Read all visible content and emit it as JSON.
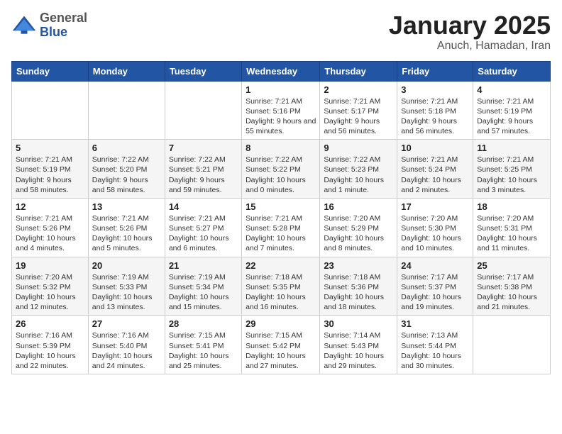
{
  "header": {
    "logo_general": "General",
    "logo_blue": "Blue",
    "month_title": "January 2025",
    "location": "Anuch, Hamadan, Iran"
  },
  "weekdays": [
    "Sunday",
    "Monday",
    "Tuesday",
    "Wednesday",
    "Thursday",
    "Friday",
    "Saturday"
  ],
  "weeks": [
    [
      {
        "day": "",
        "content": ""
      },
      {
        "day": "",
        "content": ""
      },
      {
        "day": "",
        "content": ""
      },
      {
        "day": "1",
        "content": "Sunrise: 7:21 AM\nSunset: 5:16 PM\nDaylight: 9 hours\nand 55 minutes."
      },
      {
        "day": "2",
        "content": "Sunrise: 7:21 AM\nSunset: 5:17 PM\nDaylight: 9 hours\nand 56 minutes."
      },
      {
        "day": "3",
        "content": "Sunrise: 7:21 AM\nSunset: 5:18 PM\nDaylight: 9 hours\nand 56 minutes."
      },
      {
        "day": "4",
        "content": "Sunrise: 7:21 AM\nSunset: 5:19 PM\nDaylight: 9 hours\nand 57 minutes."
      }
    ],
    [
      {
        "day": "5",
        "content": "Sunrise: 7:21 AM\nSunset: 5:19 PM\nDaylight: 9 hours\nand 58 minutes."
      },
      {
        "day": "6",
        "content": "Sunrise: 7:22 AM\nSunset: 5:20 PM\nDaylight: 9 hours\nand 58 minutes."
      },
      {
        "day": "7",
        "content": "Sunrise: 7:22 AM\nSunset: 5:21 PM\nDaylight: 9 hours\nand 59 minutes."
      },
      {
        "day": "8",
        "content": "Sunrise: 7:22 AM\nSunset: 5:22 PM\nDaylight: 10 hours\nand 0 minutes."
      },
      {
        "day": "9",
        "content": "Sunrise: 7:22 AM\nSunset: 5:23 PM\nDaylight: 10 hours\nand 1 minute."
      },
      {
        "day": "10",
        "content": "Sunrise: 7:21 AM\nSunset: 5:24 PM\nDaylight: 10 hours\nand 2 minutes."
      },
      {
        "day": "11",
        "content": "Sunrise: 7:21 AM\nSunset: 5:25 PM\nDaylight: 10 hours\nand 3 minutes."
      }
    ],
    [
      {
        "day": "12",
        "content": "Sunrise: 7:21 AM\nSunset: 5:26 PM\nDaylight: 10 hours\nand 4 minutes."
      },
      {
        "day": "13",
        "content": "Sunrise: 7:21 AM\nSunset: 5:26 PM\nDaylight: 10 hours\nand 5 minutes."
      },
      {
        "day": "14",
        "content": "Sunrise: 7:21 AM\nSunset: 5:27 PM\nDaylight: 10 hours\nand 6 minutes."
      },
      {
        "day": "15",
        "content": "Sunrise: 7:21 AM\nSunset: 5:28 PM\nDaylight: 10 hours\nand 7 minutes."
      },
      {
        "day": "16",
        "content": "Sunrise: 7:20 AM\nSunset: 5:29 PM\nDaylight: 10 hours\nand 8 minutes."
      },
      {
        "day": "17",
        "content": "Sunrise: 7:20 AM\nSunset: 5:30 PM\nDaylight: 10 hours\nand 10 minutes."
      },
      {
        "day": "18",
        "content": "Sunrise: 7:20 AM\nSunset: 5:31 PM\nDaylight: 10 hours\nand 11 minutes."
      }
    ],
    [
      {
        "day": "19",
        "content": "Sunrise: 7:20 AM\nSunset: 5:32 PM\nDaylight: 10 hours\nand 12 minutes."
      },
      {
        "day": "20",
        "content": "Sunrise: 7:19 AM\nSunset: 5:33 PM\nDaylight: 10 hours\nand 13 minutes."
      },
      {
        "day": "21",
        "content": "Sunrise: 7:19 AM\nSunset: 5:34 PM\nDaylight: 10 hours\nand 15 minutes."
      },
      {
        "day": "22",
        "content": "Sunrise: 7:18 AM\nSunset: 5:35 PM\nDaylight: 10 hours\nand 16 minutes."
      },
      {
        "day": "23",
        "content": "Sunrise: 7:18 AM\nSunset: 5:36 PM\nDaylight: 10 hours\nand 18 minutes."
      },
      {
        "day": "24",
        "content": "Sunrise: 7:17 AM\nSunset: 5:37 PM\nDaylight: 10 hours\nand 19 minutes."
      },
      {
        "day": "25",
        "content": "Sunrise: 7:17 AM\nSunset: 5:38 PM\nDaylight: 10 hours\nand 21 minutes."
      }
    ],
    [
      {
        "day": "26",
        "content": "Sunrise: 7:16 AM\nSunset: 5:39 PM\nDaylight: 10 hours\nand 22 minutes."
      },
      {
        "day": "27",
        "content": "Sunrise: 7:16 AM\nSunset: 5:40 PM\nDaylight: 10 hours\nand 24 minutes."
      },
      {
        "day": "28",
        "content": "Sunrise: 7:15 AM\nSunset: 5:41 PM\nDaylight: 10 hours\nand 25 minutes."
      },
      {
        "day": "29",
        "content": "Sunrise: 7:15 AM\nSunset: 5:42 PM\nDaylight: 10 hours\nand 27 minutes."
      },
      {
        "day": "30",
        "content": "Sunrise: 7:14 AM\nSunset: 5:43 PM\nDaylight: 10 hours\nand 29 minutes."
      },
      {
        "day": "31",
        "content": "Sunrise: 7:13 AM\nSunset: 5:44 PM\nDaylight: 10 hours\nand 30 minutes."
      },
      {
        "day": "",
        "content": ""
      }
    ]
  ]
}
